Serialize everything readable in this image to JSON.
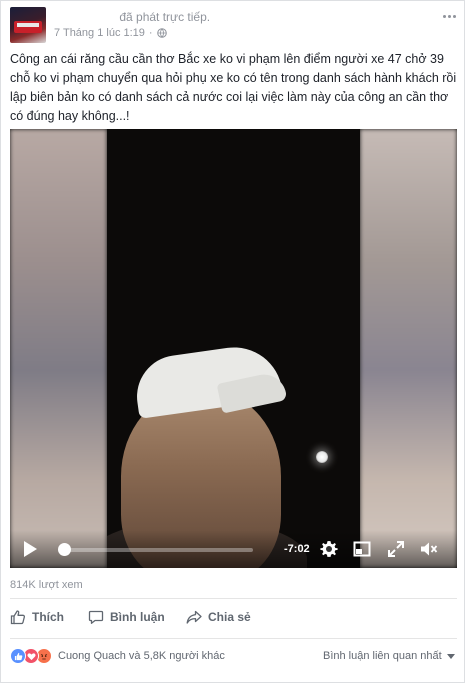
{
  "post": {
    "author_action": "đã phát trực tiếp.",
    "timestamp": "7 Tháng 1 lúc 1:19",
    "privacy_icon": "globe-icon",
    "caption": "Công an cái răng cầu cần thơ Bắc xe ko vi phạm lên điểm người xe 47 chở 39 chỗ ko vi phạm chuyển qua hỏi phụ xe ko có tên trong danh sách hành khách rồi lập biên bản ko có danh sách cả nước coi lại việc làm này của công an cần thơ có đúng hay không...!"
  },
  "video": {
    "time_remaining": "-7:02",
    "progress_fraction": 0.03
  },
  "stats": {
    "views": "814K lượt xem"
  },
  "actions": {
    "like_label": "Thích",
    "comment_label": "Bình luận",
    "share_label": "Chia sẻ"
  },
  "reactions": {
    "summary": "Cuong Quach và 5,8K người khác",
    "types": [
      "like-icon",
      "love-icon",
      "angry-icon"
    ]
  },
  "comments": {
    "sort_label": "Bình luận liên quan nhất"
  },
  "colors": {
    "meta_text": "#90949c",
    "action_text": "#606770",
    "like_blue": "#5890ff",
    "love_red": "#f25268",
    "angry_orange": "#f7714b"
  }
}
